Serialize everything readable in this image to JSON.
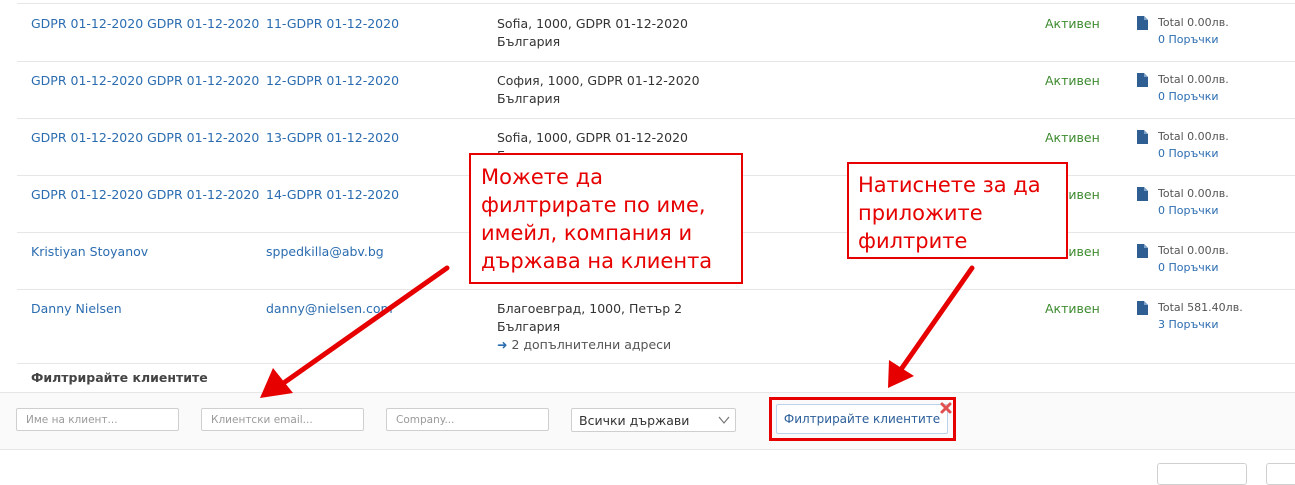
{
  "customers": [
    {
      "name": "GDPR 01-12-2020 GDPR 01-12-2020",
      "email": "11-GDPR 01-12-2020",
      "address_line1": "Sofia, 1000, GDPR 01-12-2020",
      "address_line2": "България",
      "status": "Активен",
      "total": "Total 0.00лв.",
      "orders": "0 Поръчки"
    },
    {
      "name": "GDPR 01-12-2020 GDPR 01-12-2020",
      "email": "12-GDPR 01-12-2020",
      "address_line1": "София, 1000, GDPR 01-12-2020",
      "address_line2": "България",
      "status": "Активен",
      "total": "Total 0.00лв.",
      "orders": "0 Поръчки"
    },
    {
      "name": "GDPR 01-12-2020 GDPR 01-12-2020",
      "email": "13-GDPR 01-12-2020",
      "address_line1": "Sofia, 1000, GDPR 01-12-2020",
      "address_line2": "България",
      "status": "Активен",
      "total": "Total 0.00лв.",
      "orders": "0 Поръчки"
    },
    {
      "name": "GDPR 01-12-2020 GDPR 01-12-2020",
      "email": "14-GDPR 01-12-2020",
      "address_line1": "",
      "address_line2": "",
      "status": "Активен",
      "total": "Total 0.00лв.",
      "orders": "0 Поръчки"
    },
    {
      "name": "Kristiyan Stoyanov",
      "email": "sppedkilla@abv.bg",
      "address_line1": "",
      "address_line2": "",
      "status": "Активен",
      "total": "Total 0.00лв.",
      "orders": "0 Поръчки"
    },
    {
      "name": "Danny Nielsen",
      "email": "danny@nielsen.com",
      "address_line1": "Благоевград, 1000, Петър 2",
      "address_line2": "България",
      "more_addresses": "2 допълнителни адреси",
      "status": "Активен",
      "total": "Total 581.40лв.",
      "orders": "3 Поръчки"
    }
  ],
  "filter": {
    "title": "Филтрирайте клиентите",
    "name_placeholder": "Име на клиент...",
    "email_placeholder": "Клиентски email...",
    "company_placeholder": "Company...",
    "country_selected": "Всички държави",
    "apply_label": "Филтрирайте клиентите"
  },
  "callouts": {
    "left": [
      "Можете да",
      "филтрирате по име,",
      "имейл, компания и",
      "държава на клиента"
    ],
    "right": [
      "Натиснете за да",
      "приложите",
      "филтрите"
    ]
  },
  "icons": {
    "order_doc": "document-icon",
    "more_arrow": "arrow-right-icon",
    "clear": "close-icon",
    "select": "chevron-down-icon"
  },
  "colors": {
    "link": "#2b6cb0",
    "status_active": "#3c8a2e",
    "annotation": "#e60000"
  }
}
